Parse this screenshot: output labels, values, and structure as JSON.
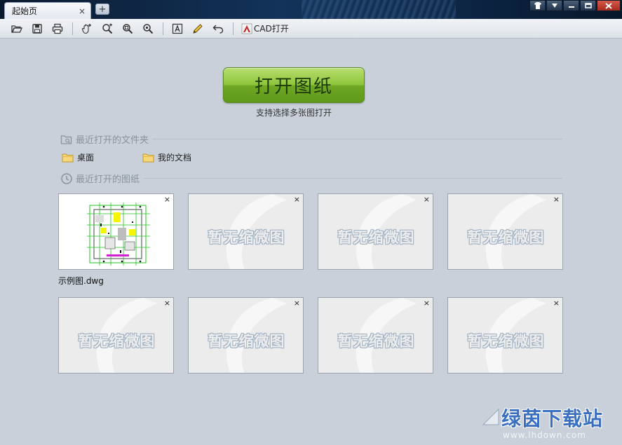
{
  "titlebar": {
    "tab_label": "起始页",
    "tab_close": "×",
    "new_tab": "+"
  },
  "toolbar": {
    "cad_open_label": "CAD打开"
  },
  "main": {
    "open_button_label": "打开图纸",
    "open_hint": "支持选择多张图打开",
    "recent_folders_title": "最近打开的文件夹",
    "folders": [
      {
        "label": "桌面"
      },
      {
        "label": "我的文档"
      }
    ],
    "recent_drawings_title": "最近打开的图纸",
    "thumbnails": [
      {
        "caption": "示例图.dwg",
        "placeholder": ""
      },
      {
        "caption": "",
        "placeholder": "暂无缩微图"
      },
      {
        "caption": "",
        "placeholder": "暂无缩微图"
      },
      {
        "caption": "",
        "placeholder": "暂无缩微图"
      },
      {
        "caption": "",
        "placeholder": "暂无缩微图"
      },
      {
        "caption": "",
        "placeholder": "暂无缩微图"
      },
      {
        "caption": "",
        "placeholder": "暂无缩微图"
      },
      {
        "caption": "",
        "placeholder": "暂无缩微图"
      }
    ],
    "thumb_close": "×"
  },
  "watermark": {
    "title": "绿茵下载站",
    "url": "www.lhdown.com"
  },
  "colors": {
    "background": "#c9d0da",
    "open_button": "#8fc63c",
    "titlebar": "#13335a"
  }
}
